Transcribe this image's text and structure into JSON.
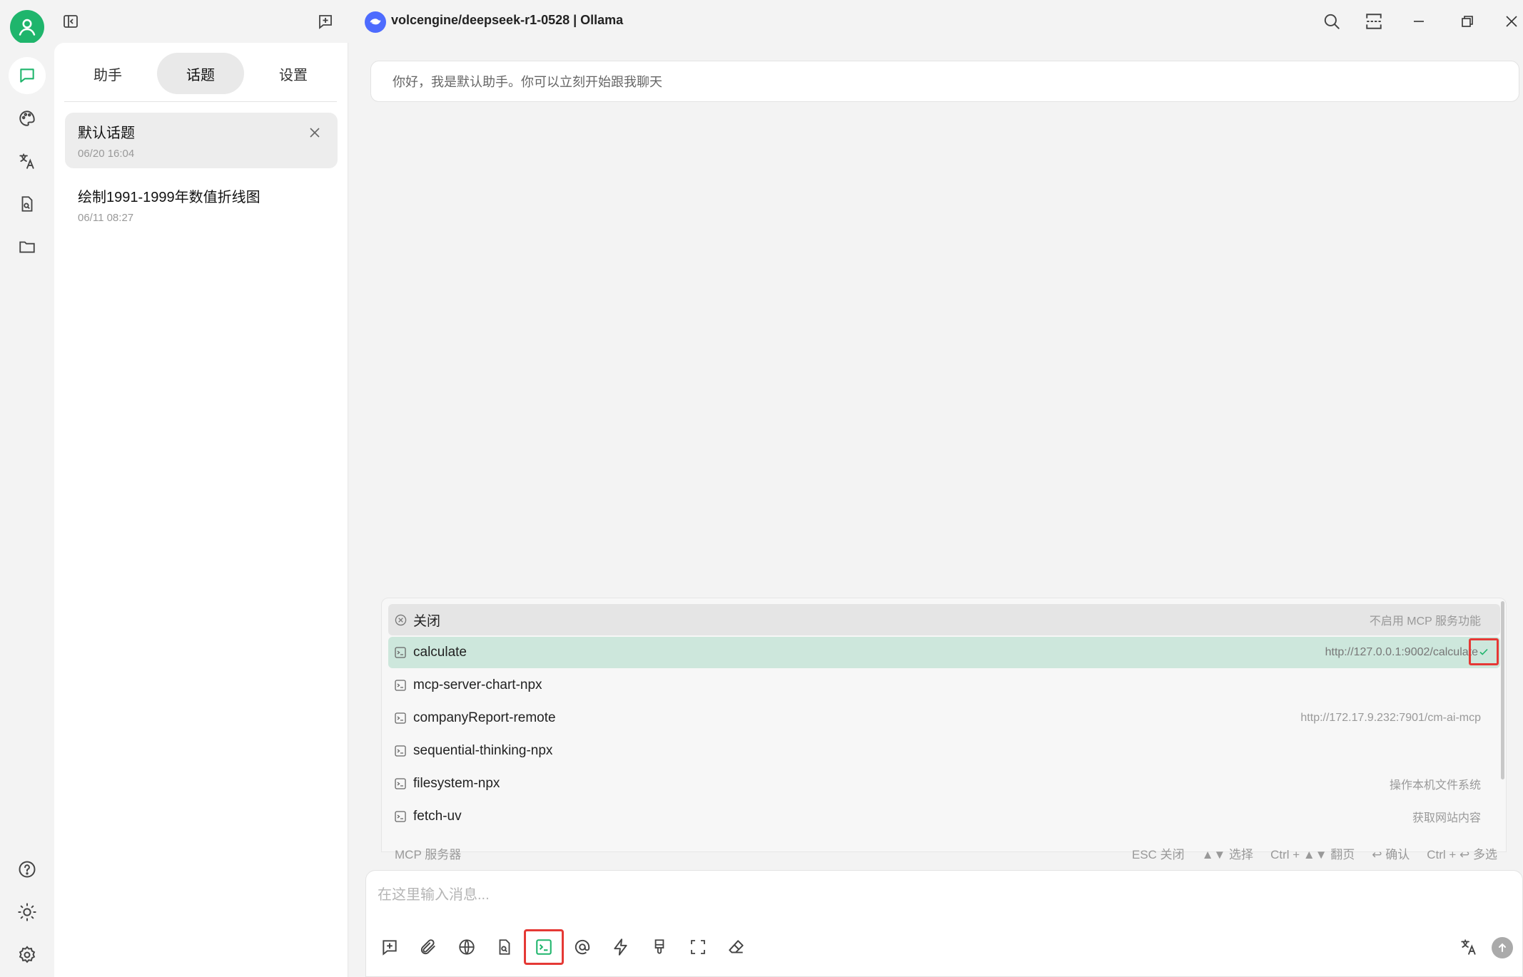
{
  "titlebar": {
    "model_title": "volcengine/deepseek-r1-0528 | Ollama"
  },
  "sidebar": {
    "tabs": [
      {
        "label": "助手"
      },
      {
        "label": "话题"
      },
      {
        "label": "设置"
      }
    ],
    "active_tab": "话题",
    "topics": [
      {
        "title": "默认话题",
        "date": "06/20 16:04"
      },
      {
        "title": "绘制1991-1999年数值折线图",
        "date": "06/11 08:27"
      }
    ]
  },
  "main": {
    "welcome_message": "你好，我是默认助手。你可以立刻开始跟我聊天"
  },
  "mcp_popup": {
    "items": [
      {
        "name": "关闭",
        "desc": "不启用 MCP 服务功能"
      },
      {
        "name": "calculate",
        "desc": "http://127.0.0.1:9002/calculate"
      },
      {
        "name": "mcp-server-chart-npx",
        "desc": ""
      },
      {
        "name": "companyReport-remote",
        "desc": "http://172.17.9.232:7901/cm-ai-mcp"
      },
      {
        "name": "sequential-thinking-npx",
        "desc": ""
      },
      {
        "name": "filesystem-npx",
        "desc": "操作本机文件系统"
      },
      {
        "name": "fetch-uv",
        "desc": "获取网站内容"
      }
    ],
    "selected_item": "calculate",
    "footer_title": "MCP 服务器",
    "hints": [
      "ESC 关闭",
      "▲▼ 选择",
      "Ctrl + ▲▼ 翻页",
      "↩ 确认",
      "Ctrl + ↩ 多选"
    ]
  },
  "input": {
    "placeholder": "在这里输入消息..."
  },
  "colors": {
    "accent_green": "#1fb56c",
    "selected_row": "#cde7dc",
    "highlight_red": "#e53935",
    "model_logo_blue": "#4d6bfe"
  },
  "icons": {
    "titlebar": [
      "user-avatar-icon",
      "sidebar-toggle-icon",
      "new-topic-icon",
      "search-icon",
      "expand-icon",
      "minimize-icon",
      "restore-icon",
      "close-icon"
    ],
    "rail": [
      "chat-icon",
      "palette-icon",
      "translate-icon",
      "file-search-icon",
      "folder-icon",
      "help-icon",
      "theme-icon",
      "settings-icon"
    ],
    "toolbar": [
      "new-topic-icon",
      "attachment-icon",
      "web-search-icon",
      "knowledge-icon",
      "mcp-terminal-icon",
      "mention-icon",
      "quick-phrase-icon",
      "clear-style-icon",
      "fullscreen-icon",
      "eraser-icon",
      "translate-icon",
      "send-icon"
    ]
  }
}
